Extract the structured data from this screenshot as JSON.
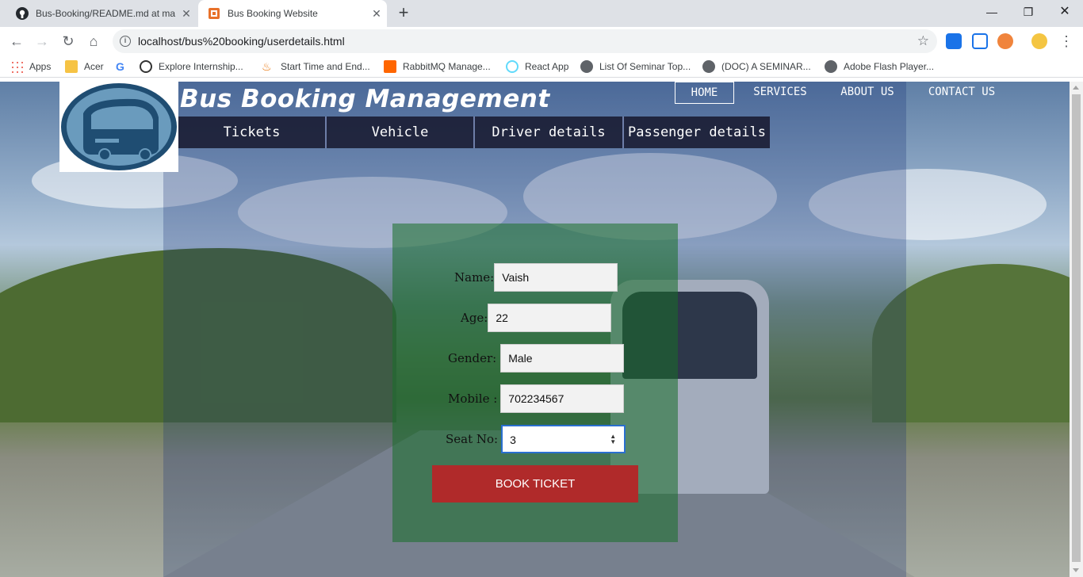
{
  "browser": {
    "tabs": [
      {
        "title": "Bus-Booking/README.md at ma",
        "icon": "github-icon"
      },
      {
        "title": "Bus Booking Website",
        "icon": "html-page-icon"
      }
    ],
    "url": "localhost/bus%20booking/userdetails.html",
    "bookmarks": [
      "Apps",
      "Acer",
      "Explore Internship...",
      "Start Time and End...",
      "RabbitMQ Manage...",
      "React App",
      "List Of Seminar Top...",
      "(DOC) A SEMINAR...",
      "Adobe Flash Player..."
    ]
  },
  "site": {
    "title": "Bus Booking Management",
    "top_nav": [
      "HOME",
      "SERVICES",
      "ABOUT US",
      "CONTACT US"
    ],
    "sub_nav": [
      "Tickets",
      "Vehicle",
      "Driver details",
      "Passenger details"
    ]
  },
  "form": {
    "name_label": "Name:",
    "name_value": "Vaish",
    "age_label": "Age:",
    "age_value": "22",
    "gender_label": "Gender:",
    "gender_value": "Male",
    "mobile_label": "Mobile :",
    "mobile_value": "702234567",
    "seat_label": "Seat No:",
    "seat_value": "3",
    "submit_label": "BOOK TICKET"
  },
  "colors": {
    "book_button": "#b02a2a",
    "form_panel": "#186e28",
    "logo_bus": "#1f4d72"
  }
}
